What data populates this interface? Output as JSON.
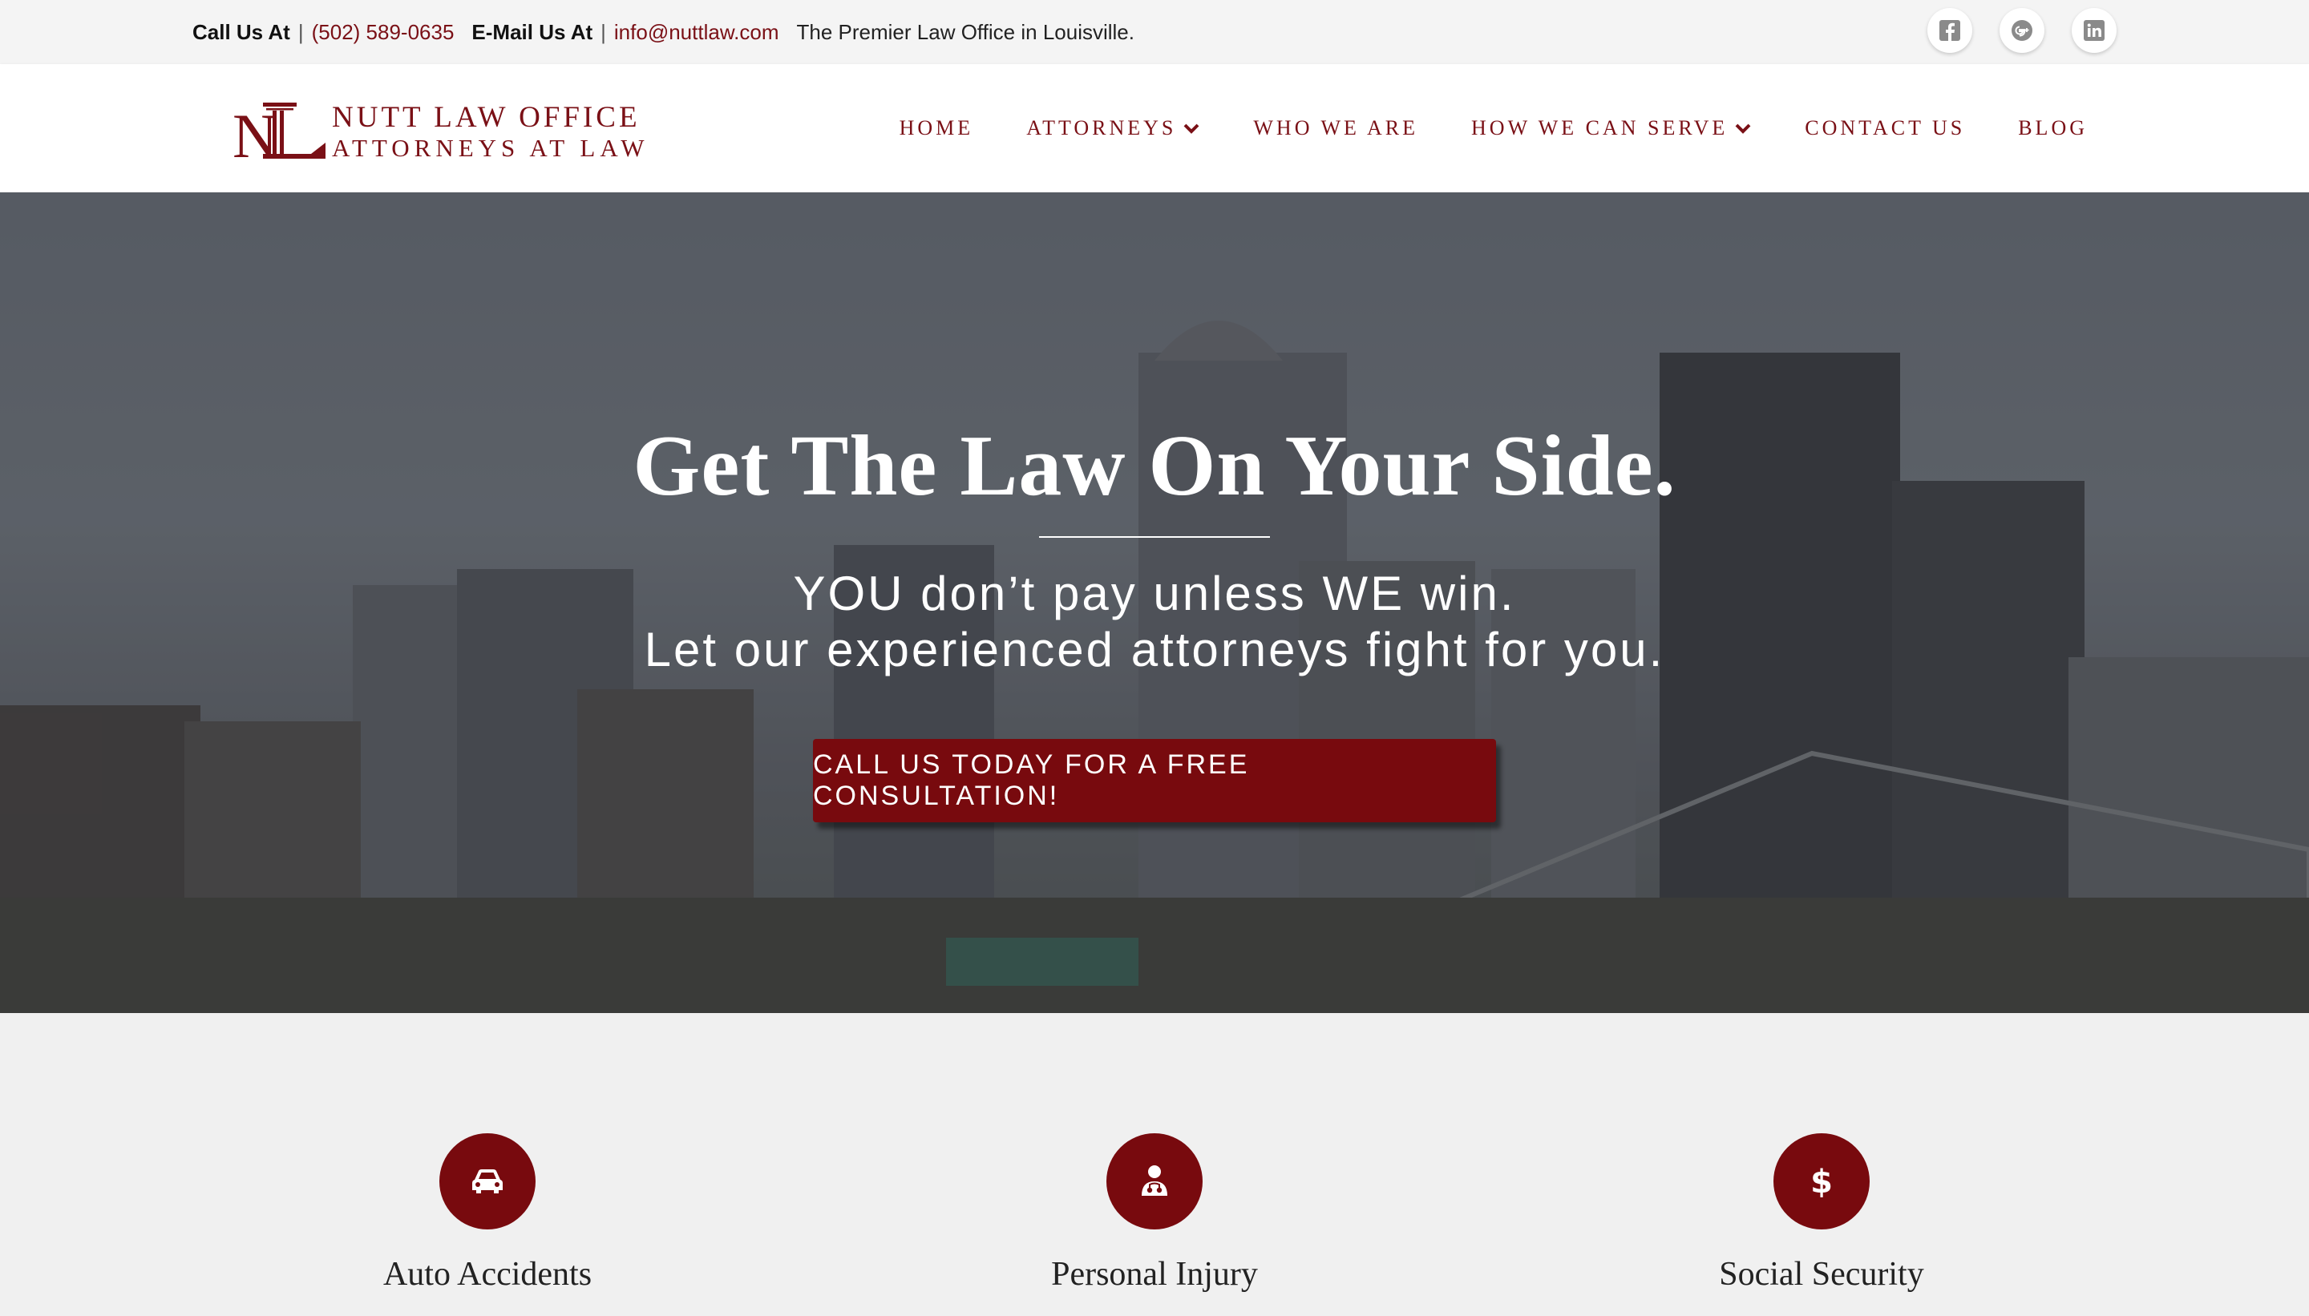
{
  "topbar": {
    "call_label": "Call Us At",
    "phone": "(502) 589-0635",
    "email_label": "E-Mail Us At",
    "email": "info@nuttlaw.com",
    "tagline": "The Premier Law Office in Louisville.",
    "separator": "|",
    "socials": [
      {
        "icon": "facebook-icon"
      },
      {
        "icon": "google-plus-icon"
      },
      {
        "icon": "linkedin-icon"
      }
    ]
  },
  "logo": {
    "monogram": "NL",
    "line1": "NUTT LAW OFFICE",
    "line2": "ATTORNEYS AT LAW"
  },
  "nav": {
    "items": [
      {
        "label": "HOME",
        "dropdown": false
      },
      {
        "label": "ATTORNEYS",
        "dropdown": true
      },
      {
        "label": "WHO WE ARE",
        "dropdown": false
      },
      {
        "label": "HOW WE CAN SERVE",
        "dropdown": true
      },
      {
        "label": "CONTACT US",
        "dropdown": false
      },
      {
        "label": "BLOG",
        "dropdown": false
      }
    ]
  },
  "hero": {
    "title": "Get The Law On Your Side.",
    "subtitle_line1": "YOU don’t pay unless WE win.",
    "subtitle_line2": "Let our experienced attorneys fight for you.",
    "cta_label": "CALL US TODAY FOR A FREE CONSULTATION!"
  },
  "services": [
    {
      "label": "Auto Accidents",
      "icon": "car-icon"
    },
    {
      "label": "Personal Injury",
      "icon": "injured-person-icon"
    },
    {
      "label": "Social Security",
      "icon": "dollar-icon"
    }
  ],
  "colors": {
    "brand": "#780a0e",
    "topbar_bg": "#f4f4f4",
    "services_bg": "#f0f0f0"
  }
}
